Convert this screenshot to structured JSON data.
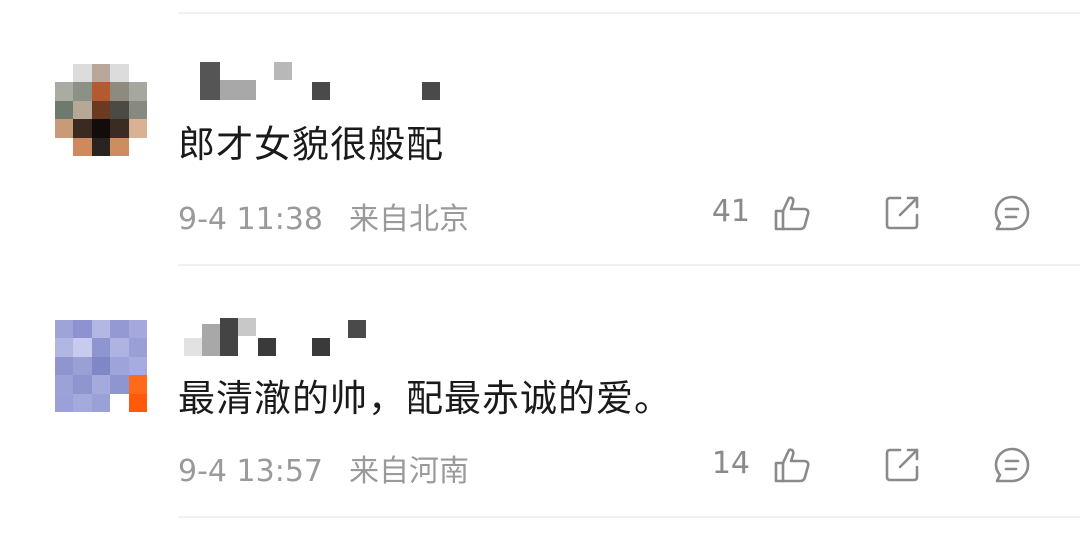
{
  "comments": [
    {
      "text": "郎才女貌很般配",
      "time": "9-4 11:38",
      "location": "来自北京",
      "likes": "41",
      "avatar_icon": "pixelated-avatar",
      "username_icon": "pixelated-username"
    },
    {
      "text": "最清澈的帅，配最赤诚的爱。",
      "time": "9-4 13:57",
      "location": "来自河南",
      "likes": "14",
      "avatar_icon": "pixelated-avatar",
      "username_icon": "pixelated-username"
    }
  ],
  "icons": {
    "like": "thumbs-up-icon",
    "share": "share-icon",
    "reply": "comment-icon"
  },
  "colors": {
    "text": "#1a1a1a",
    "meta": "#9a9a9a",
    "icon": "#8a8a8a",
    "divider": "#f0f0f0"
  }
}
